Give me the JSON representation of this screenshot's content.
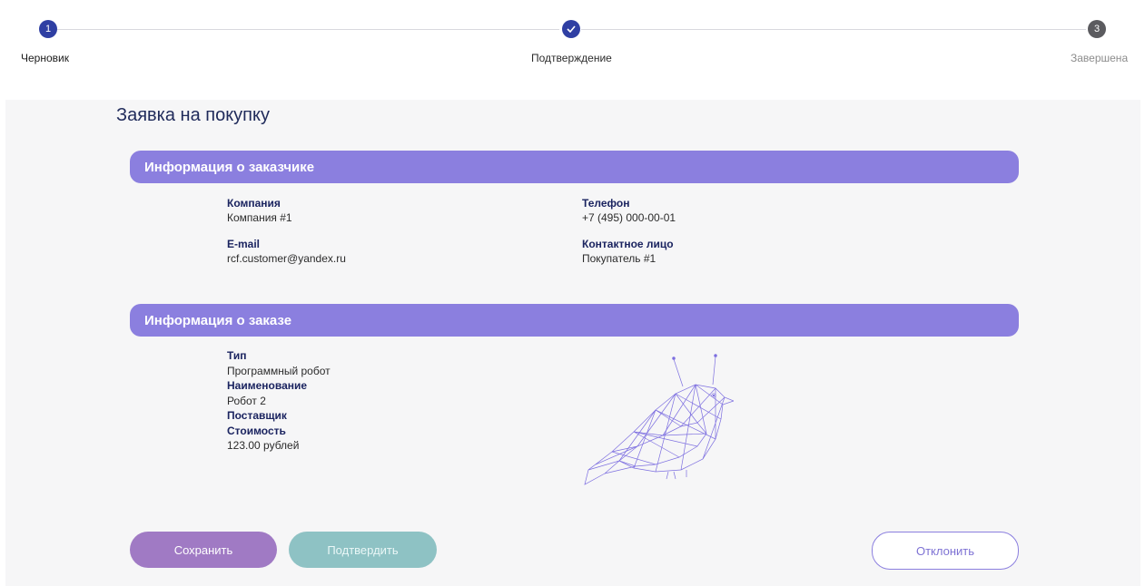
{
  "stepper": {
    "steps": [
      {
        "number": "1",
        "label": "Черновик",
        "state": "active"
      },
      {
        "number": "",
        "label": "Подтверждение",
        "state": "done"
      },
      {
        "number": "3",
        "label": "Завершена",
        "state": "pending"
      }
    ]
  },
  "page": {
    "title": "Заявка на покупку"
  },
  "customer": {
    "header": "Информация о заказчике",
    "company_label": "Компания",
    "company_value": "Компания #1",
    "phone_label": "Телефон",
    "phone_value": "+7 (495) 000-00-01",
    "email_label": "E-mail",
    "email_value": "rcf.customer@yandex.ru",
    "contact_label": "Контактное лицо",
    "contact_value": "Покупатель #1"
  },
  "order": {
    "header": "Информация о заказе",
    "type_label": "Тип",
    "type_value": "Программный робот",
    "name_label": "Наименование",
    "name_value": "Робот 2",
    "supplier_label": "Поставщик",
    "price_label": "Стоимость",
    "price_value": "123.00 рублей",
    "image_icon": "robot-bird-illustration"
  },
  "actions": {
    "save_label": "Сохранить",
    "confirm_label": "Подтвердить",
    "reject_label": "Отклонить"
  },
  "colors": {
    "accent": "#8b7fdf",
    "step_active": "#2f3fa3",
    "save_button": "#a07ac4",
    "confirm_button": "#8ec2c4"
  }
}
